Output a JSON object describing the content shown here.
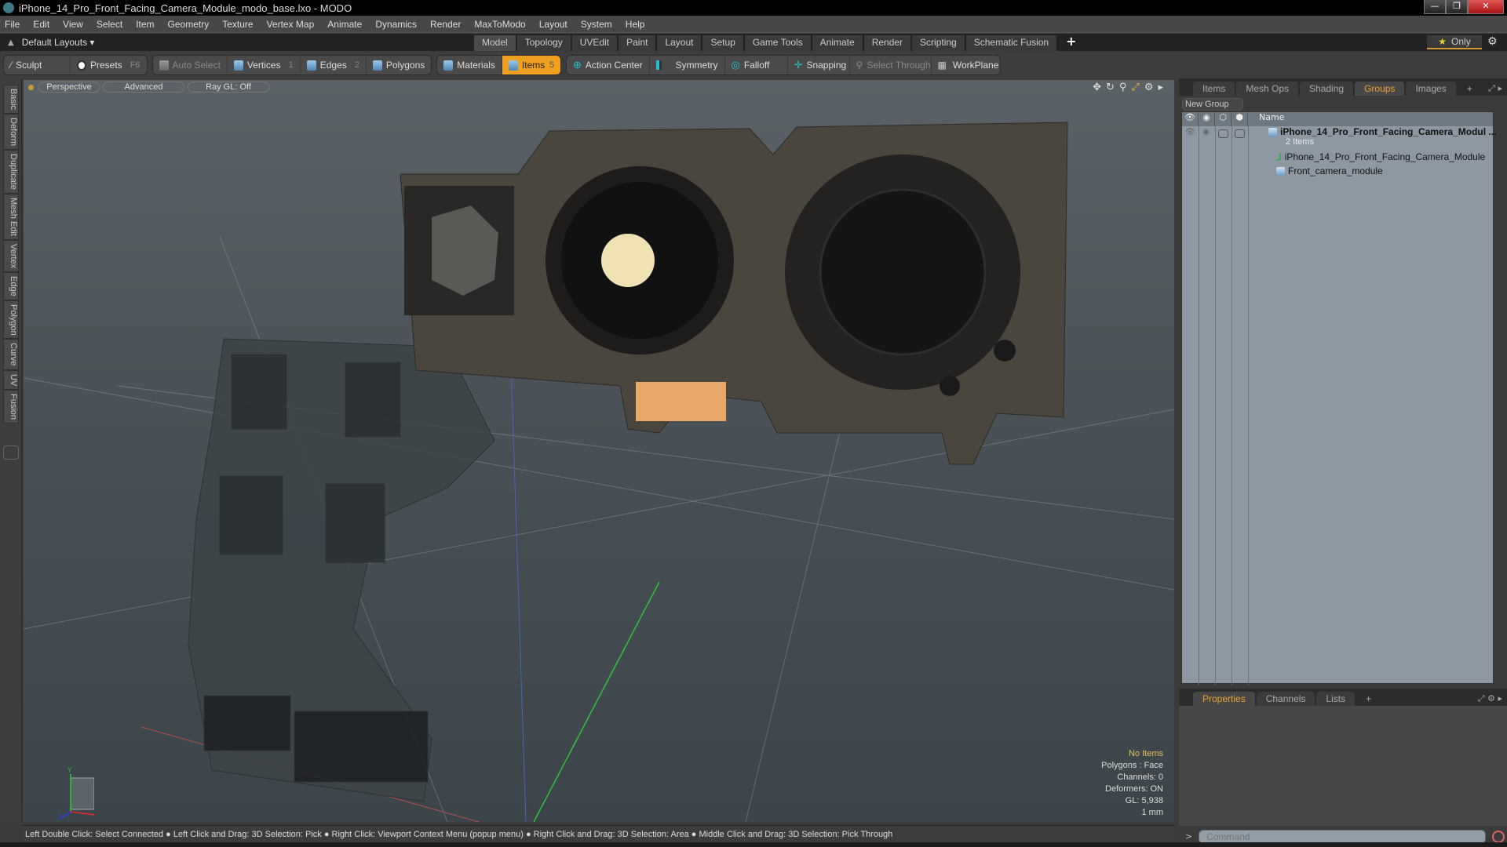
{
  "window": {
    "title": "iPhone_14_Pro_Front_Facing_Camera_Module_modo_base.lxo - MODO",
    "controls": [
      "minimize",
      "restore",
      "close"
    ]
  },
  "menubar": [
    "File",
    "Edit",
    "View",
    "Select",
    "Item",
    "Geometry",
    "Texture",
    "Vertex Map",
    "Animate",
    "Dynamics",
    "Render",
    "MaxToModo",
    "Layout",
    "System",
    "Help"
  ],
  "layoutbar": {
    "layout_menu": "Default Layouts ▾",
    "tabs": [
      "Model",
      "Topology",
      "UVEdit",
      "Paint",
      "Layout",
      "Setup",
      "Game Tools",
      "Animate",
      "Render",
      "Scripting",
      "Schematic Fusion"
    ],
    "active_tab": "Model",
    "add_label": "+",
    "only_label": "Only"
  },
  "toolbar": {
    "sculpt": "Sculpt",
    "presets": "Presets",
    "presets_key": "F6",
    "auto_select": "Auto Select",
    "vertices": "Vertices",
    "vertices_key": "1",
    "edges": "Edges",
    "edges_key": "2",
    "polygons": "Polygons",
    "materials": "Materials",
    "items": "Items",
    "items_key": "5",
    "action_center": "Action Center",
    "symmetry": "Symmetry",
    "falloff": "Falloff",
    "snapping": "Snapping",
    "select_through": "Select Through",
    "workplane": "WorkPlane"
  },
  "left_tabs": [
    "Basic",
    "Deform",
    "Duplicate",
    "Mesh Edit",
    "Vertex",
    "Edge",
    "Polygon",
    "Curve",
    "UV",
    "Fusion"
  ],
  "viewport": {
    "view_mode": "Perspective",
    "shading": "Advanced",
    "raygl": "Ray GL: Off",
    "hud": {
      "selection": "No Items",
      "polygons": "Polygons : Face",
      "channels": "Channels: 0",
      "deformers": "Deformers: ON",
      "gl": "GL: 5,938",
      "unit": "1 mm"
    },
    "axis_labels": {
      "y": "Y",
      "x": "X",
      "z": "Z"
    }
  },
  "groups_panel": {
    "tabs": [
      "Items",
      "Mesh Ops",
      "Shading",
      "Groups",
      "Images"
    ],
    "active_tab": "Groups",
    "new_group": "New Group",
    "column_name": "Name",
    "rows": [
      {
        "name": "iPhone_14_Pro_Front_Facing_Camera_Modul ...",
        "sub": "2 Items",
        "type": "group"
      },
      {
        "name": "iPhone_14_Pro_Front_Facing_Camera_Module",
        "type": "locator"
      },
      {
        "name": "Front_camera_module",
        "type": "mesh"
      }
    ]
  },
  "properties_panel": {
    "tabs": [
      "Properties",
      "Channels",
      "Lists"
    ],
    "active_tab": "Properties"
  },
  "command": {
    "placeholder": "Command",
    "prompt": ">"
  },
  "statusbar": "Left Double Click: Select Connected ● Left Click and Drag: 3D Selection: Pick ● Right Click: Viewport Context Menu (popup menu) ● Right Click and Drag: 3D Selection: Area ● Middle Click and Drag: 3D Selection: Pick Through"
}
